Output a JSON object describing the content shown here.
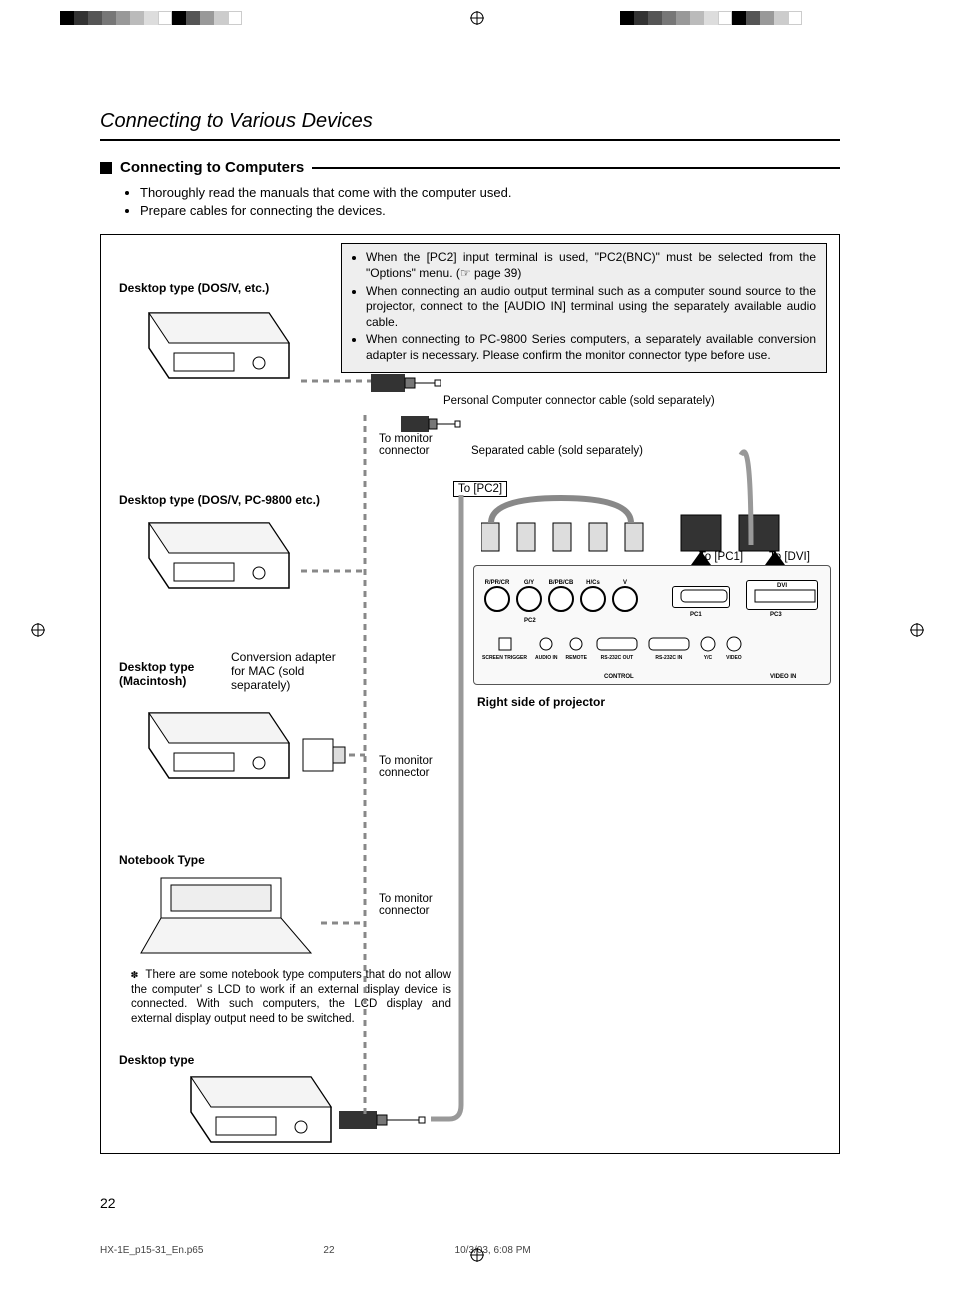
{
  "page": {
    "title": "Connecting to Various Devices",
    "section_title": "Connecting to Computers",
    "intro_bullets": [
      "Thoroughly read the manuals that come with the computer used.",
      "Prepare cables for connecting the devices."
    ],
    "notes": [
      "When the [PC2] input terminal is used, \"PC2(BNC)\" must be selected from the \"Options\" menu. (☞ page 39)",
      "When connecting an audio output terminal such as a computer sound source to the projector, connect to the [AUDIO IN] terminal using the separately available audio cable.",
      "When connecting to PC-9800 Series computers, a separately available conversion adapter is necessary. Please confirm the monitor connector type before use."
    ],
    "labels": {
      "desktop1": "Desktop type (DOS/V, etc.)",
      "desktop2": "Desktop type (DOS/V, PC-9800 etc.)",
      "desktop_mac": "Desktop type (Macintosh)",
      "conversion_adapter": "Conversion adapter for MAC (sold separately)",
      "notebook": "Notebook Type",
      "desktop_bottom": "Desktop type",
      "pc_cable": "Personal Computer connector cable (sold separately)",
      "sep_cable": "Separated cable (sold separately)",
      "to_monitor": "To monitor connector",
      "to_pc2": "To [PC2]",
      "to_pc1": "To [PC1]",
      "to_dvi": "To [DVI]",
      "projector_side": "Right side of projector"
    },
    "notebook_note": "There are some notebook type computers that do not allow the computer' s LCD to work if an external display device is connected. With such computers, the LCD display and external display output need to be switched.",
    "panel_ports": {
      "bnc": [
        "R/PR/CR",
        "G/Y",
        "B/PB/CB",
        "H/Cs",
        "V"
      ],
      "pc2": "PC2",
      "pc1": "PC1",
      "pc3": "PC3",
      "dvi": "DVI",
      "screen_trigger": "SCREEN TRIGGER",
      "audio_in": "AUDIO IN",
      "remote": "REMOTE",
      "rs232_out": "RS-232C OUT",
      "rs232_in": "RS-232C IN",
      "control": "CONTROL",
      "yc": "Y/C",
      "video": "VIDEO",
      "video_in": "VIDEO IN"
    },
    "page_number": "22",
    "footer_file": "HX-1E_p15-31_En.p65",
    "footer_page": "22",
    "footer_date": "10/3/03, 6:08 PM"
  }
}
